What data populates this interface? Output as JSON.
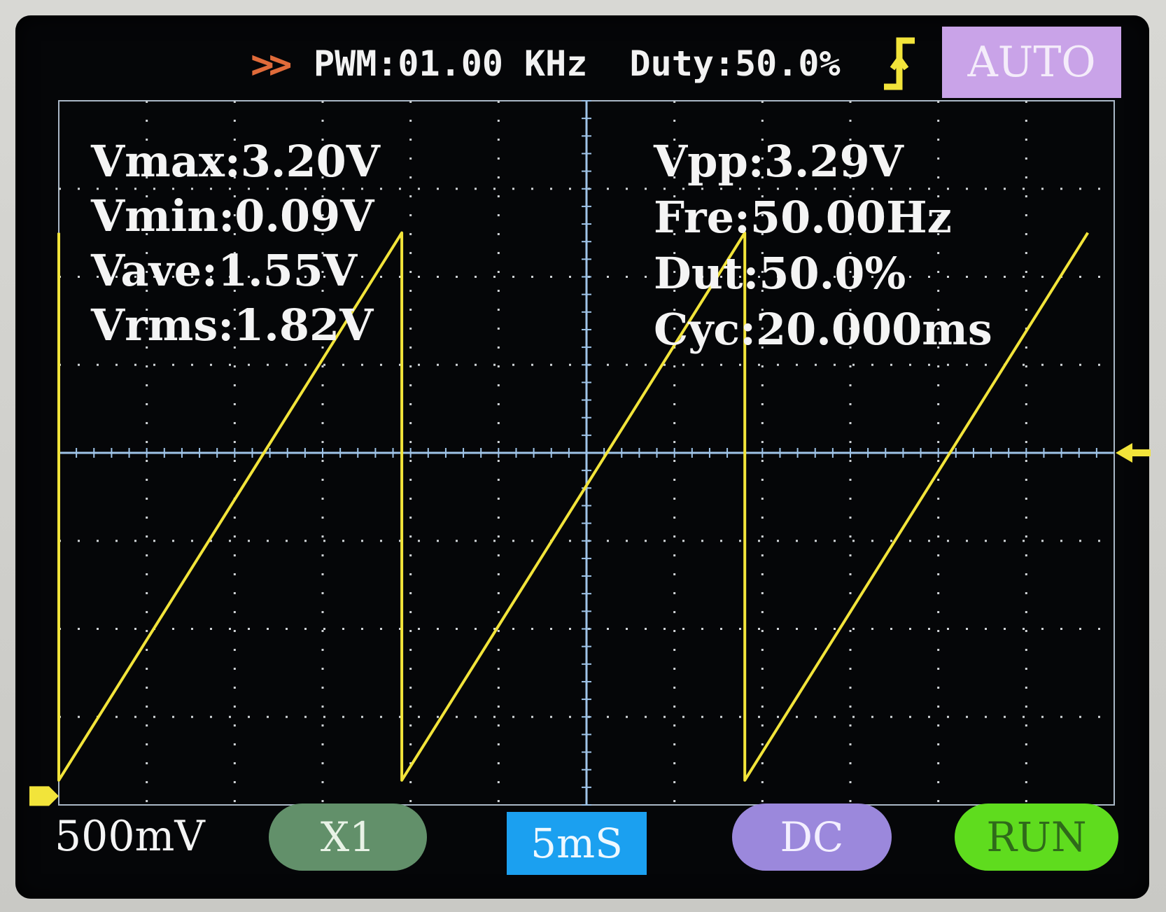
{
  "top_bar": {
    "arrows": ">>",
    "pwm_status": "PWM:01.00 KHz  Duty:50.0%",
    "trigger_mode": "AUTO"
  },
  "measurements": {
    "vmax": "Vmax:3.20V",
    "vmin": "Vmin:0.09V",
    "vave": "Vave:1.55V",
    "vrms": "Vrms:1.82V",
    "vpp": "Vpp:3.29V",
    "fre": "Fre:50.00Hz",
    "dut": "Dut:50.0%",
    "cyc": "Cyc:20.000ms"
  },
  "bottom_bar": {
    "volts_per_div": "500mV",
    "probe": "X1",
    "timebase": "5mS",
    "coupling": "DC",
    "run_state": "RUN"
  },
  "colors": {
    "trace": "#f2e43a",
    "grid": "#cfd3d6",
    "axis": "#9fc4e8",
    "marker": "#f2e43a"
  },
  "chart_data": {
    "type": "line",
    "title": "",
    "xlabel": "",
    "ylabel": "",
    "divisions": {
      "x": 12,
      "y": 8
    },
    "volts_per_div": 0.5,
    "time_per_div_ms": 5,
    "xlim_ms": [
      0,
      60
    ],
    "ylim_div": [
      -4,
      4
    ],
    "series": [
      {
        "values": [
          {
            "t": 0.0,
            "v": 3.2
          },
          {
            "t": 0.0,
            "v": 0.09
          },
          {
            "t": 19.5,
            "v": 3.2
          },
          {
            "t": 19.5,
            "v": 0.09
          },
          {
            "t": 39.0,
            "v": 3.2
          },
          {
            "t": 39.0,
            "v": 0.09
          },
          {
            "t": 58.5,
            "v": 3.2
          }
        ]
      }
    ]
  }
}
